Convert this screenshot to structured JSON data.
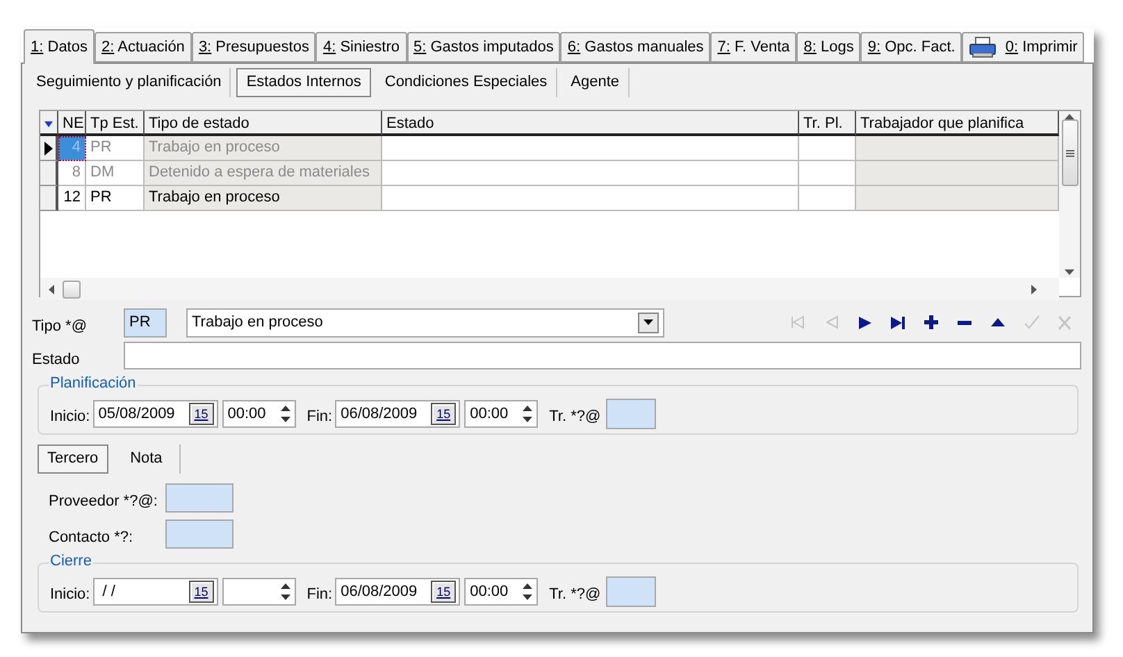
{
  "tabs": [
    {
      "label": "1: Datos",
      "selected": true
    },
    {
      "label": "2: Actuación",
      "selected": false
    },
    {
      "label": "3: Presupuestos",
      "selected": false
    },
    {
      "label": "4: Siniestro",
      "selected": false
    },
    {
      "label": "5: Gastos imputados",
      "selected": false
    },
    {
      "label": "6: Gastos manuales",
      "selected": false
    },
    {
      "label": "7: F. Venta",
      "selected": false
    },
    {
      "label": "8: Logs",
      "selected": false
    },
    {
      "label": "9: Opc. Fact.",
      "selected": false
    },
    {
      "label": "0: Imprimir",
      "selected": false,
      "kind": "print"
    }
  ],
  "subtabs": [
    {
      "label": "Seguimiento y planificación",
      "selected": false
    },
    {
      "label": "Estados Internos",
      "selected": true
    },
    {
      "label": "Condiciones Especiales",
      "selected": false
    },
    {
      "label": "Agente",
      "selected": false
    }
  ],
  "grid": {
    "columns": [
      {
        "label": "NE",
        "readonly": false
      },
      {
        "label": "Tp Est.",
        "readonly": false
      },
      {
        "label": "Tipo de estado",
        "readonly": true
      },
      {
        "label": "Estado",
        "readonly": false
      },
      {
        "label": "Tr. Pl.",
        "readonly": false
      },
      {
        "label": "Trabajador que planifica",
        "readonly": true
      }
    ],
    "rows": [
      {
        "ne": "4",
        "tp": "PR",
        "tipo": "Trabajo en proceso",
        "selected": true,
        "disabled": true
      },
      {
        "ne": "8",
        "tp": "DM",
        "tipo": "Detenido a espera de materiales",
        "selected": false,
        "disabled": true
      },
      {
        "ne": "12",
        "tp": "PR",
        "tipo": "Trabajo en proceso",
        "selected": false,
        "disabled": false
      }
    ]
  },
  "tipo": {
    "label": "Tipo *@",
    "code": "PR",
    "value": "Trabajo en proceso"
  },
  "navigator": [
    {
      "kind": "first",
      "disabled": true
    },
    {
      "kind": "prior",
      "disabled": true
    },
    {
      "kind": "next",
      "disabled": false
    },
    {
      "kind": "last",
      "disabled": false
    },
    {
      "kind": "insert",
      "disabled": false
    },
    {
      "kind": "delete",
      "disabled": false
    },
    {
      "kind": "edit",
      "disabled": false
    },
    {
      "kind": "post",
      "disabled": true
    },
    {
      "kind": "cancel",
      "disabled": true
    }
  ],
  "estado": {
    "label": "Estado"
  },
  "planificacion": {
    "title": "Planificación",
    "inicio_label": "Inicio:",
    "inicio_date": "05/08/2009",
    "inicio_picker": "15",
    "inicio_time": "00:00",
    "fin_label": "Fin:",
    "fin_date": "06/08/2009",
    "fin_picker": "15",
    "fin_time": "00:00",
    "tr_label": "Tr. *?@"
  },
  "lower_tabs": [
    {
      "label": "Tercero",
      "selected": true
    },
    {
      "label": "Nota",
      "selected": false
    }
  ],
  "proveedor": {
    "label": "Proveedor *?@:"
  },
  "contacto": {
    "label": "Contacto *?:"
  },
  "cierre": {
    "title": "Cierre",
    "inicio_label": "Inicio:",
    "inicio_date": " / /",
    "inicio_picker": "15",
    "fin_label": "Fin:",
    "fin_date": "06/08/2009",
    "fin_picker": "15",
    "fin_time": "00:00",
    "tr_label": "Tr. *?@"
  }
}
